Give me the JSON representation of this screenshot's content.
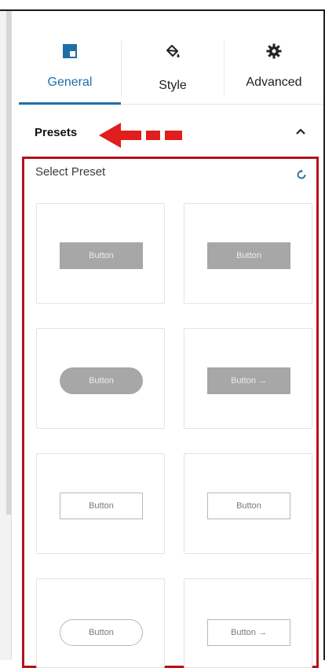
{
  "tabs": [
    {
      "label": "General",
      "icon": "layout-icon",
      "active": true
    },
    {
      "label": "Style",
      "icon": "paint-bucket-icon",
      "active": false
    },
    {
      "label": "Advanced",
      "icon": "gear-icon",
      "active": false
    }
  ],
  "presets": {
    "section_label": "Presets",
    "select_label": "Select Preset",
    "items": [
      {
        "label": "Button",
        "style": "filled-square"
      },
      {
        "label": "Button",
        "style": "filled-square"
      },
      {
        "label": "Button",
        "style": "filled-pill"
      },
      {
        "label": "Button →",
        "style": "filled-square-arrow"
      },
      {
        "label": "Button",
        "style": "outline-square"
      },
      {
        "label": "Button",
        "style": "outline-square"
      },
      {
        "label": "Button",
        "style": "outline-pill"
      },
      {
        "label": "Button →",
        "style": "outline-square-arrow"
      }
    ]
  },
  "colors": {
    "accent": "#1e6fa8",
    "annotation_red": "#e11d1d",
    "highlight_border": "#b5121b"
  }
}
